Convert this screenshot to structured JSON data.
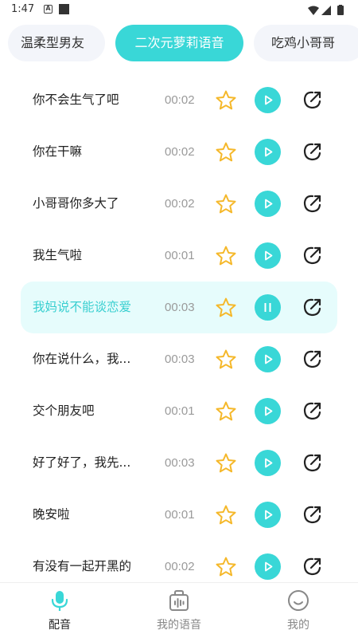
{
  "status_bar": {
    "time": "1:47",
    "icons": [
      "a-notification-icon",
      "square-notification-icon",
      "wifi-icon",
      "signal-icon",
      "battery-icon"
    ]
  },
  "tabs": [
    {
      "label": "温柔型男友",
      "active": false
    },
    {
      "label": "二次元萝莉语音",
      "active": true
    },
    {
      "label": "吃鸡小哥哥",
      "active": false
    }
  ],
  "voices": [
    {
      "title": "你不会生气了吧",
      "duration": "00:02",
      "playing": false
    },
    {
      "title": "你在干嘛",
      "duration": "00:02",
      "playing": false
    },
    {
      "title": "小哥哥你多大了",
      "duration": "00:02",
      "playing": false
    },
    {
      "title": "我生气啦",
      "duration": "00:01",
      "playing": false
    },
    {
      "title": "我妈说不能谈恋爱",
      "duration": "00:03",
      "playing": true
    },
    {
      "title": "你在说什么，我...",
      "duration": "00:03",
      "playing": false
    },
    {
      "title": "交个朋友吧",
      "duration": "00:01",
      "playing": false
    },
    {
      "title": "好了好了，我先...",
      "duration": "00:03",
      "playing": false
    },
    {
      "title": "晚安啦",
      "duration": "00:01",
      "playing": false
    },
    {
      "title": "有没有一起开黑的",
      "duration": "00:02",
      "playing": false
    }
  ],
  "bottom_nav": [
    {
      "label": "配音",
      "icon": "microphone-icon",
      "active": true
    },
    {
      "label": "我的语音",
      "icon": "voice-bag-icon",
      "active": false
    },
    {
      "label": "我的",
      "icon": "smiley-icon",
      "active": false
    }
  ],
  "colors": {
    "accent": "#39d7d7",
    "active_row_bg": "#e6fcfc",
    "star": "#f5b82a",
    "tab_bg": "#f3f5fa"
  }
}
